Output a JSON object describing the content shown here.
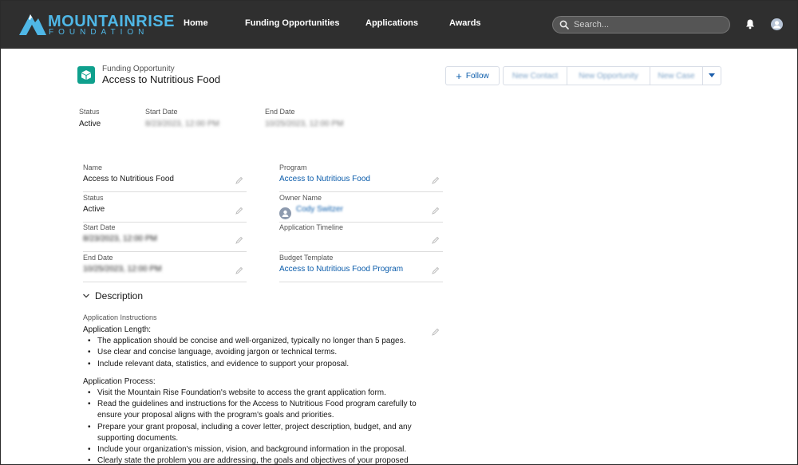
{
  "nav": {
    "logo": {
      "word1_bold": "MOUNTAIN",
      "word2": "RISE",
      "subtitle": "FOUNDATION"
    },
    "items": [
      {
        "label": "Home"
      },
      {
        "label": "Funding Opportunities"
      },
      {
        "label": "Applications"
      },
      {
        "label": "Awards"
      }
    ],
    "search_placeholder": "Search...",
    "icons": [
      "search-icon",
      "bell-icon",
      "user-avatar-icon"
    ]
  },
  "header": {
    "record_type": "Funding Opportunity",
    "title": "Access to Nutritious Food",
    "icon": "box-icon",
    "icon_color": "#0fa08d",
    "buttons": {
      "follow": "Follow",
      "new_contact": "New Contact",
      "new_opportunity": "New Opportunity",
      "new_case": "New Case"
    }
  },
  "highlights": {
    "status_label": "Status",
    "status_value": "Active",
    "start_label": "Start Date",
    "start_value": "8/23/2023, 12:00 PM",
    "end_label": "End Date",
    "end_value": "10/25/2023, 12:00 PM"
  },
  "fields": {
    "name_label": "Name",
    "name_value": "Access to Nutritious Food",
    "status_label": "Status",
    "status_value": "Active",
    "start_label": "Start Date",
    "start_value": "8/23/2023, 12:00 PM",
    "end_label": "End Date",
    "end_value": "10/25/2023, 12:00 PM",
    "program_label": "Program",
    "program_value": "Access to Nutritious Food",
    "owner_label": "Owner Name",
    "owner_value": "Cody Switzer",
    "timeline_label": "Application Timeline",
    "timeline_value": "",
    "budget_label": "Budget Template",
    "budget_value": "Access to Nutritious Food Program"
  },
  "description": {
    "section_title": "Description",
    "field_label": "Application Instructions",
    "length_heading": "Application Length:",
    "length_items": [
      "The application should be concise and well-organized, typically no longer than 5 pages.",
      "Use clear and concise language, avoiding jargon or technical terms.",
      "Include relevant data, statistics, and evidence to support your proposal."
    ],
    "process_heading": "Application Process:",
    "process_items": [
      "Visit the Mountain Rise Foundation's website to access the grant application form.",
      "Read the guidelines and instructions for the Access to Nutritious Food program carefully to ensure your proposal aligns with the program's goals and priorities.",
      "Prepare your grant proposal, including a cover letter, project description, budget, and any supporting documents.",
      "Include your organization's mission, vision, and background information in the proposal.",
      "Clearly state the problem you are addressing, the goals and objectives of your proposed"
    ]
  }
}
